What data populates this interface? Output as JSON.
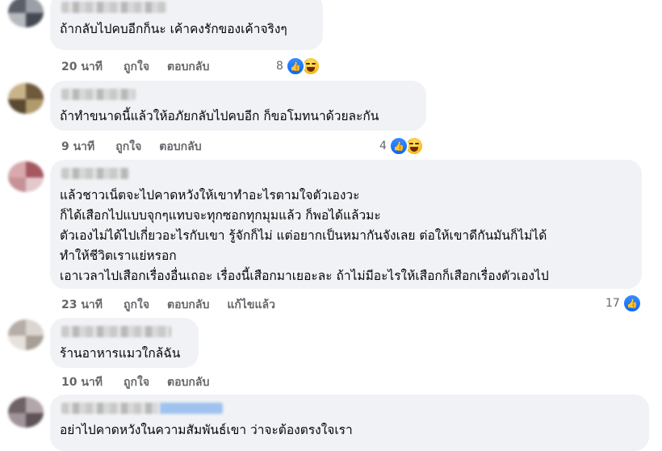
{
  "comments": [
    {
      "text_lines": [
        "ถ้ากลับไปคบอีกก็นะ เค้าคงรักของเค้าจริงๆ"
      ],
      "time": "20 นาที",
      "like": "ถูกใจ",
      "reply": "ตอบกลับ",
      "reaction_count": "8",
      "reactions": [
        "like-icon",
        "haha-icon"
      ]
    },
    {
      "text_lines": [
        "ถ้าทำขนาดนี้แล้วให้อภัยกลับไปคบอีก ก็ขอโมทนาด้วยละกัน"
      ],
      "time": "9 นาที",
      "like": "ถูกใจ",
      "reply": "ตอบกลับ",
      "reaction_count": "4",
      "reactions": [
        "like-icon",
        "haha-icon"
      ]
    },
    {
      "text_lines": [
        "แล้วชาวเน็ตจะไปคาดหวังให้เขาทำอะไรตามใจตัวเองวะ",
        "ก็ได้เสือกไปแบบจุกๆแทบจะทุกซอกทุกมุมแล้ว ก็พอได้แล้วมะ",
        "ตัวเองไม่ได้ไปเกี่ยวอะไรกับเขา รู้จักก็ไม่ แต่อยากเป็นหมากันจังเลย ต่อให้เขาดีกันมันก็ไม่ได้",
        "ทำให้ชีวิตเราแย่หรอก",
        "เอาเวลาไปเสือกเรื่องอื่นเถอะ เรื่องนี้เสือกมาเยอะละ ถ้าไม่มีอะไรให้เสือกก็เสือกเรื่องตัวเองไป"
      ],
      "time": "23 นาที",
      "like": "ถูกใจ",
      "reply": "ตอบกลับ",
      "edited": "แก้ไขแล้ว",
      "reaction_count": "17",
      "reactions": [
        "like-icon"
      ]
    },
    {
      "text_lines": [
        "ร้านอาหารแมวใกล้ฉัน"
      ],
      "time": "10 นาที",
      "like": "ถูกใจ",
      "reply": "ตอบกลับ"
    },
    {
      "text_lines": [
        "อย่าไปคาดหวังในความสัมพันธ์เขา ว่าจะต้องตรงใจเรา"
      ]
    }
  ],
  "colors": {
    "bubble": "#f0f2f5",
    "meta_text": "#65676b",
    "like_blue": "#0866ff"
  }
}
